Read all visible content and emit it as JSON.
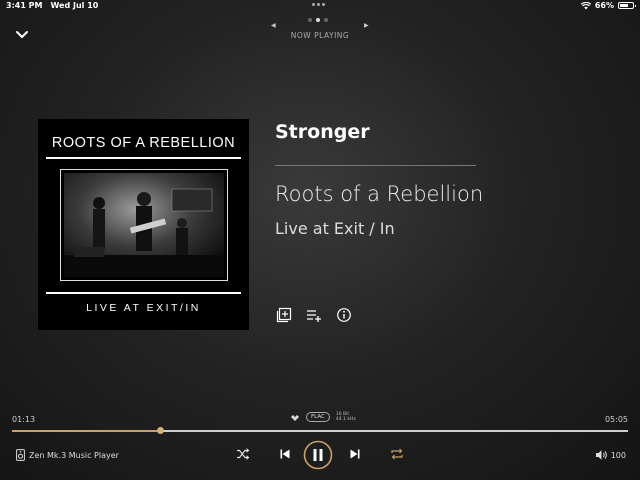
{
  "status": {
    "time": "3:41 PM",
    "date": "Wed Jul 10",
    "battery": "66%",
    "battery_level": 0.66
  },
  "header": {
    "label": "NOW PLAYING",
    "page_count": 3,
    "active_page": 1
  },
  "album_art": {
    "title": "ROOTS OF A REBELLION",
    "subtitle": "LIVE AT EXIT/IN"
  },
  "track": {
    "title": "Stronger",
    "artist": "Roots of a Rebellion",
    "album": "Live at Exit / In"
  },
  "actions": [
    "add-to-library",
    "add-to-queue",
    "info"
  ],
  "playback": {
    "elapsed": "01:13",
    "duration": "05:05",
    "progress_fraction": 0.24,
    "format": "FLAC",
    "bit_depth": "16 Bit",
    "sample_rate": "44.1 kHz"
  },
  "device": {
    "name": "Zen Mk.3 Music Player"
  },
  "volume": {
    "level": "100"
  },
  "colors": {
    "accent": "#c9a26a",
    "background": "#232323"
  }
}
